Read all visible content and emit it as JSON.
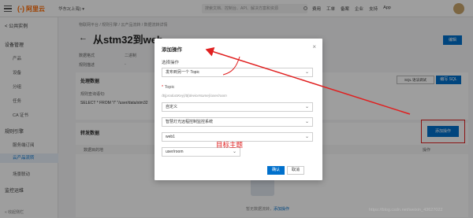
{
  "topbar": {
    "logo_mark": "(-)",
    "logo_text": "阿里云",
    "region": "华东2(上海) ▾",
    "search_placeholder": "搜索文档、控制台、API、解决方案和资源",
    "nav": [
      "费用",
      "工单",
      "备案",
      "企业",
      "支持",
      "App"
    ]
  },
  "sidebar": {
    "back_label": "< 公共实例",
    "sections": [
      {
        "label": "设备管理",
        "items": [
          "产品",
          "设备",
          "分组",
          "任务",
          "CA 证书"
        ]
      },
      {
        "label": "规则引擎",
        "items": [
          "服务端订阅",
          "云产品流转",
          "场景联动"
        ]
      },
      {
        "label": "监控运维",
        "items": []
      }
    ],
    "active_item": "云产品流转",
    "collapse_label": "« 收起侧栏"
  },
  "main": {
    "breadcrumb": "物联网平台 / 规则引擎 / 云产品流转 / 数据流转详情",
    "title": "从stm32到web",
    "edit_label": "编辑",
    "meta": [
      {
        "label": "数据格式",
        "value": "二进制"
      },
      {
        "label": "规则描述",
        "value": "-"
      }
    ],
    "process_title": "处理数据",
    "sql_debug_label": "SQL 语法调试",
    "edit_sql_label": "编写 SQL",
    "query_label": "规则查询语句:",
    "query_value": "SELECT * FROM \"/\" \"/user/data/stm32",
    "forward_title": "转发数据",
    "add_op_label": "添加操作",
    "table_headers": [
      "数据目的地",
      "操作"
    ],
    "empty_text": "暂无数据流转，",
    "empty_link": "添加操作"
  },
  "dialog": {
    "title": "添加操作",
    "close": "×",
    "op_label": "选择操作",
    "op_value": "发布到另一个 Topic",
    "topic_label": "Topic",
    "topic_hint": "/${productKey}/${deviceName}/user/room",
    "topic_fields": [
      "自定义",
      "智慧灯光远程控制监控系统",
      "web1",
      "user/room"
    ],
    "confirm": "确认",
    "cancel": "取消"
  },
  "annotation": {
    "label": "目标主题",
    "color": "#e02020"
  },
  "watermark": "https://blog.csdn.net/weixin_43627022"
}
